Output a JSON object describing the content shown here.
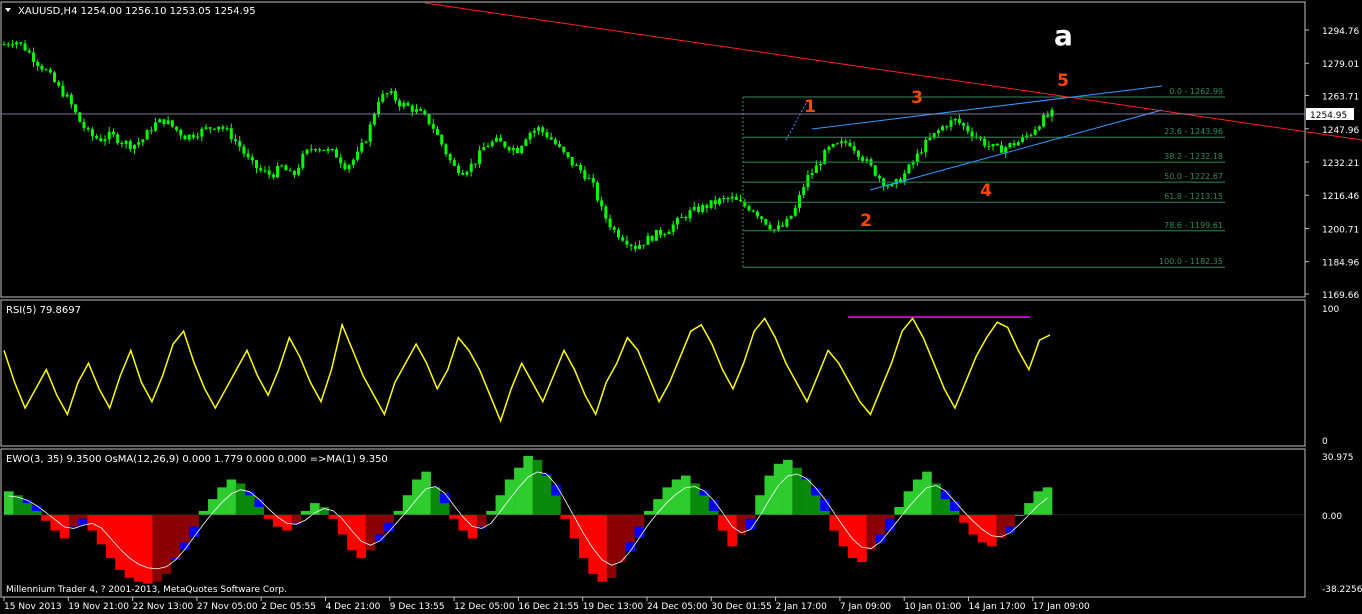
{
  "header": {
    "symbol_info": "XAUUSD,H4  1254.00 1256.10 1253.05 1254.95",
    "rsi_label": "RSI(5) 79.8697",
    "ewo_label": "EWO(3, 35) 9.3500  OsMA(12,26,9) 0.000 1.779 0.000 0.000  =>MA(1) 9.350",
    "copyright": "Millennium Trader 4, ? 2001-2013, MetaQuotes Software Corp."
  },
  "annotations": {
    "wave_a": "a",
    "wave_labels": [
      "1",
      "2",
      "3",
      "4",
      "5"
    ]
  },
  "colors": {
    "background": "#000000",
    "grid_border": "#c0c0c0",
    "candle": "#00ff00",
    "rsi_line": "#ffff00",
    "ewo_green": "#2ecc2e",
    "ewo_darkgreen": "#0a8a0a",
    "ewo_red": "#ff0000",
    "ewo_darkred": "#8b0000",
    "ewo_blue": "#0000ff",
    "trendline_red": "#ff2020",
    "channel_blue": "#3399ff",
    "fib": "#2e8b57",
    "wave_label": "#ff4500",
    "resistance_magenta": "#ff00ff"
  },
  "chart_data": [
    {
      "type": "candlestick",
      "title": "XAUUSD,H4",
      "price_axis_ticks": [
        "1294.76",
        "1279.01",
        "1263.71",
        "1247.96",
        "1232.21",
        "1216.46",
        "1200.71",
        "1184.96",
        "1169.66"
      ],
      "current_price": "1254.95",
      "ylim": [
        1169.66,
        1294.76
      ],
      "time_labels": [
        "15 Nov 2013",
        "19 Nov 21:00",
        "22 Nov 13:00",
        "27 Nov 05:00",
        "2 Dec 05:55",
        "4 Dec 21:00",
        "9 Dec 13:55",
        "12 Dec 05:00",
        "16 Dec 21:55",
        "19 Dec 13:00",
        "24 Dec 05:00",
        "30 Dec 01:55",
        "2 Jan 17:00",
        "7 Jan 09:00",
        "10 Jan 01:00",
        "14 Jan 17:00",
        "17 Jan 09:00"
      ],
      "close_path": [
        1288,
        1290,
        1286,
        1280,
        1275,
        1268,
        1262,
        1252,
        1245,
        1243,
        1245,
        1242,
        1240,
        1243,
        1250,
        1252,
        1248,
        1244,
        1246,
        1248,
        1250,
        1246,
        1240,
        1232,
        1228,
        1226,
        1230,
        1225,
        1235,
        1240,
        1238,
        1236,
        1230,
        1235,
        1245,
        1262,
        1265,
        1260,
        1258,
        1255,
        1250,
        1240,
        1230,
        1228,
        1232,
        1240,
        1242,
        1240,
        1238,
        1246,
        1248,
        1244,
        1238,
        1232,
        1228,
        1222,
        1208,
        1200,
        1196,
        1192,
        1195,
        1198,
        1200,
        1204,
        1208,
        1210,
        1212,
        1214,
        1215,
        1212,
        1210,
        1205,
        1200,
        1202,
        1210,
        1224,
        1230,
        1238,
        1240,
        1242,
        1236,
        1230,
        1224,
        1220,
        1225,
        1232,
        1240,
        1245,
        1250,
        1252,
        1248,
        1244,
        1240,
        1238,
        1240,
        1242,
        1246,
        1252,
        1255
      ],
      "fibonacci": [
        {
          "level": "0.0",
          "price": 1262.99,
          "label": "0.0 - 1262.99"
        },
        {
          "level": "23.6",
          "price": 1243.96,
          "label": "23.6 - 1243.96"
        },
        {
          "level": "38.2",
          "price": 1232.18,
          "label": "38.2 - 1232.18"
        },
        {
          "level": "50.0",
          "price": 1222.67,
          "label": "50.0 - 1222.67"
        },
        {
          "level": "61.8",
          "price": 1213.15,
          "label": "61.8 - 1213.15"
        },
        {
          "level": "78.6",
          "price": 1199.61,
          "label": "78.6 - 1199.61"
        },
        {
          "level": "100.0",
          "price": 1182.35,
          "label": "100.0 - 1182.35"
        }
      ]
    },
    {
      "type": "line",
      "title": "RSI(5) 79.8697",
      "ylim": [
        0,
        100
      ],
      "axis_ticks": [
        "100",
        "0"
      ],
      "values": [
        70,
        45,
        25,
        40,
        55,
        35,
        20,
        45,
        60,
        40,
        25,
        50,
        70,
        45,
        30,
        50,
        75,
        85,
        60,
        40,
        25,
        40,
        55,
        70,
        50,
        35,
        55,
        80,
        65,
        45,
        30,
        55,
        90,
        70,
        50,
        35,
        20,
        45,
        60,
        75,
        60,
        40,
        55,
        80,
        70,
        55,
        35,
        15,
        40,
        60,
        45,
        30,
        50,
        70,
        55,
        35,
        20,
        45,
        60,
        80,
        70,
        50,
        30,
        45,
        65,
        85,
        90,
        75,
        55,
        40,
        60,
        85,
        95,
        80,
        60,
        45,
        30,
        50,
        70,
        60,
        45,
        30,
        20,
        40,
        60,
        85,
        95,
        80,
        60,
        40,
        25,
        45,
        65,
        80,
        92,
        88,
        70,
        55,
        78,
        82
      ]
    },
    {
      "type": "bar",
      "title": "EWO(3, 35) 9.3500",
      "axis_ticks": [
        "30.975",
        "0.00",
        "-38.2256"
      ],
      "ylim": [
        -38.2256,
        30.975
      ],
      "values": [
        12,
        10,
        6,
        2,
        -3,
        -8,
        -12,
        -6,
        -2,
        -8,
        -15,
        -22,
        -28,
        -32,
        -34,
        -35,
        -34,
        -30,
        -22,
        -14,
        -6,
        2,
        8,
        14,
        18,
        16,
        10,
        4,
        -2,
        -6,
        -8,
        -4,
        2,
        6,
        4,
        -2,
        -10,
        -18,
        -22,
        -18,
        -10,
        -4,
        2,
        10,
        18,
        22,
        14,
        6,
        -2,
        -8,
        -12,
        -6,
        2,
        10,
        18,
        24,
        30,
        28,
        20,
        10,
        -2,
        -12,
        -22,
        -30,
        -34,
        -32,
        -24,
        -14,
        -6,
        2,
        8,
        14,
        18,
        20,
        16,
        10,
        2,
        -8,
        -16,
        -10,
        -2,
        10,
        20,
        26,
        28,
        24,
        18,
        10,
        2,
        -8,
        -16,
        -22,
        -24,
        -18,
        -10,
        -2,
        4,
        12,
        18,
        22,
        16,
        8,
        2,
        -4,
        -10,
        -14,
        -16,
        -12,
        -6,
        0,
        6,
        12,
        14
      ]
    }
  ]
}
